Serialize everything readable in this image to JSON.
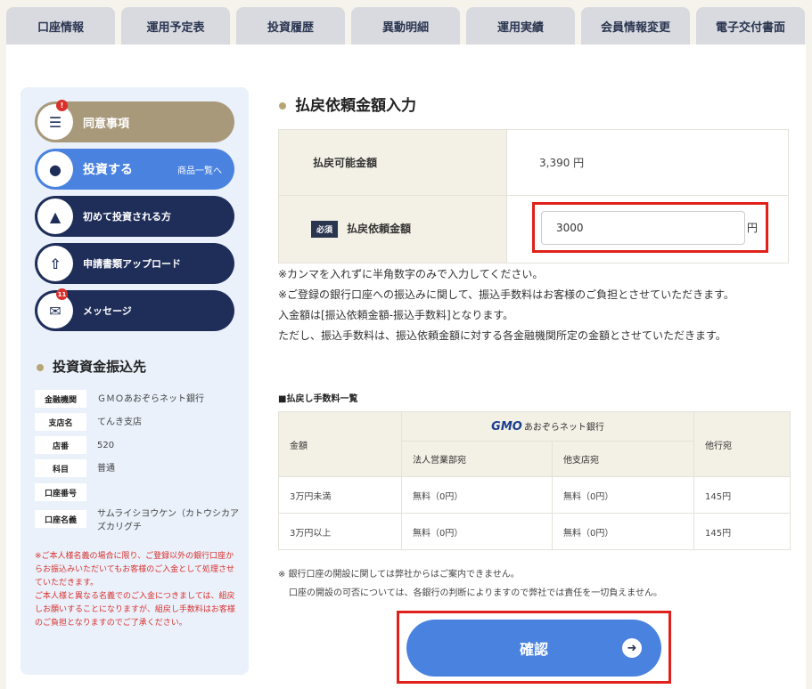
{
  "tabs": [
    "口座情報",
    "運用予定表",
    "投資履歴",
    "異動明細",
    "運用実績",
    "会員情報変更",
    "電子交付書面"
  ],
  "sidebar": {
    "menu": {
      "agree": {
        "label": "同意事項",
        "badge": "!"
      },
      "invest": {
        "label": "投資する",
        "sub": "商品一覧へ"
      },
      "first": {
        "label": "初めて投資される方"
      },
      "upload": {
        "label": "申請書類アップロード"
      },
      "message": {
        "label": "メッセージ",
        "badge": "11"
      }
    },
    "bank_heading": "投資資金振込先",
    "bank": [
      {
        "key": "金融機関",
        "value": "ＧＭＯあおぞらネット銀行"
      },
      {
        "key": "支店名",
        "value": "てんき支店"
      },
      {
        "key": "店番",
        "value": "520"
      },
      {
        "key": "科目",
        "value": "普通"
      },
      {
        "key": "口座番号",
        "value": ""
      },
      {
        "key": "口座名義",
        "value": "サムライシヨウケン（カトウシカアズカリグチ"
      }
    ],
    "note": "※ご本人様名義の場合に限り、ご登録以外の銀行口座からお振込みいただいてもお客様のご入金として処理させていただきます。\nご本人様と異なる名義でのご入金につきましては、組戻しお願いすることになりますが、組戻し手数料はお客様のご負担となりますのでご了承ください。"
  },
  "content": {
    "title": "払戻依頼金額入力",
    "available_label": "払戻可能金額",
    "available_value": "3,390 円",
    "required_tag": "必須",
    "request_label": "払戻依頼金額",
    "request_value": "3000",
    "yen": "円",
    "notes": [
      "※カンマを入れずに半角数字のみで入力してください。",
      "※ご登録の銀行口座への振込みに関して、振込手数料はお客様のご負担とさせていただきます。",
      "入金額は[振込依頼金額-振込手数料]となります。",
      "ただし、振込手数料は、振込依頼金額に対する各金融機関所定の金額とさせていただきます。"
    ],
    "fee_heading": "■払戻し手数料一覧",
    "fee_table": {
      "col_amount": "金額",
      "gmo_logo": "GMO",
      "gmo_bank": "あおぞらネット銀行",
      "col_corp": "法人営業部宛",
      "col_other_branch": "他支店宛",
      "col_other_bank": "他行宛",
      "rows": [
        {
          "amount": "3万円未満",
          "corp": "無料（0円）",
          "other_branch": "無料（0円）",
          "other_bank": "145円"
        },
        {
          "amount": "3万円以上",
          "corp": "無料（0円）",
          "other_branch": "無料（0円）",
          "other_bank": "145円"
        }
      ]
    },
    "bottom_notes": [
      "※ 銀行口座の開設に関しては弊社からはご案内できません。",
      "口座の開設の可否については、各銀行の判断によりますので弊社では責任を一切負えません。"
    ],
    "confirm_label": "確認",
    "arrow_icon": "arrow-right-icon"
  }
}
